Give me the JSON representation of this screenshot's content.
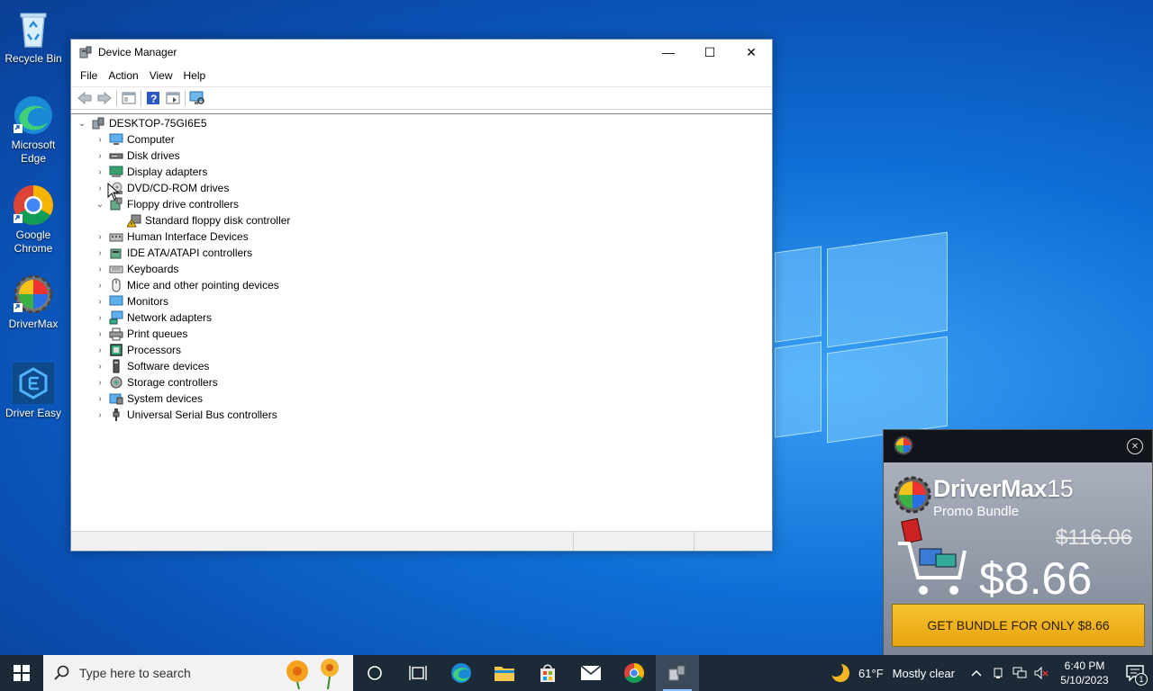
{
  "desktop": {
    "icons": [
      {
        "label": "Recycle Bin"
      },
      {
        "label": "Microsoft Edge"
      },
      {
        "label": "Google Chrome"
      },
      {
        "label": "DriverMax"
      },
      {
        "label": "Driver Easy"
      }
    ]
  },
  "window": {
    "title": "Device Manager",
    "controls": {
      "minimize": "—",
      "maximize": "☐",
      "close": "✕"
    },
    "menu": [
      "File",
      "Action",
      "View",
      "Help"
    ],
    "tree": {
      "root": "DESKTOP-75GI6E5",
      "items": [
        {
          "label": "Computer"
        },
        {
          "label": "Disk drives"
        },
        {
          "label": "Display adapters"
        },
        {
          "label": "DVD/CD-ROM drives"
        },
        {
          "label": "Floppy drive controllers"
        },
        {
          "label": "Standard floppy disk controller"
        },
        {
          "label": "Human Interface Devices"
        },
        {
          "label": "IDE ATA/ATAPI controllers"
        },
        {
          "label": "Keyboards"
        },
        {
          "label": "Mice and other pointing devices"
        },
        {
          "label": "Monitors"
        },
        {
          "label": "Network adapters"
        },
        {
          "label": "Print queues"
        },
        {
          "label": "Processors"
        },
        {
          "label": "Software devices"
        },
        {
          "label": "Storage controllers"
        },
        {
          "label": "System devices"
        },
        {
          "label": "Universal Serial Bus controllers"
        }
      ]
    }
  },
  "promo": {
    "brand": "DriverMax",
    "version": "15",
    "subtitle": "Promo Bundle",
    "old_price": "$116.06",
    "new_price": "$8.66",
    "cta": "GET BUNDLE FOR ONLY $8.66",
    "close": "✕"
  },
  "taskbar": {
    "search_placeholder": "Type here to search",
    "weather_temp": "61°F",
    "weather_text": "Mostly clear",
    "time": "6:40 PM",
    "date": "5/10/2023",
    "notification_count": "1"
  },
  "colors": {
    "accent": "#0f6fd6",
    "taskbar": "#1c2a38",
    "cta": "#f2b51f"
  }
}
